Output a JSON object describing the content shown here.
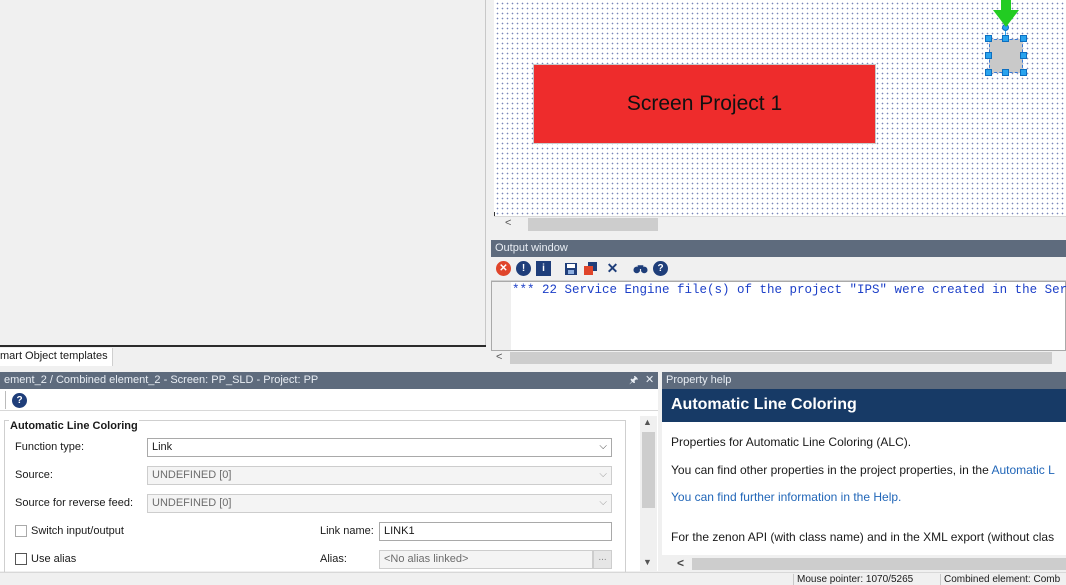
{
  "left_panel": {
    "tab_label": "mart Object templates"
  },
  "screen_editor": {
    "rect_label": "Screen  Project 1",
    "rect_color": "#ee2c2c",
    "selection_color": "#29a3ee",
    "arrow_color": "#22cc22"
  },
  "output_window": {
    "title": "Output window",
    "toolbar_icons": [
      "error-filter-icon",
      "warning-filter-icon",
      "info-filter-icon",
      "save-icon",
      "copy-icon",
      "clear-icon",
      "find-icon",
      "help-icon"
    ],
    "line": "*** 22 Service Engine file(s) of the project \"IPS\" were created in the Ser"
  },
  "properties": {
    "title": "ement_2 / Combined element_2 - Screen: PP_SLD - Project: PP",
    "pin_glyph": "🖈",
    "close_glyph": "✕",
    "help_glyph": "?",
    "group_title": "Automatic Line Coloring",
    "function_type": {
      "label": "Function type:",
      "value": "Link"
    },
    "source": {
      "label": "Source:",
      "value": "UNDEFINED [0]"
    },
    "source_reverse": {
      "label": "Source for reverse feed:",
      "value": "UNDEFINED [0]"
    },
    "switch_io": {
      "label": "Switch input/output"
    },
    "link_name": {
      "label": "Link name:",
      "value": "LINK1"
    },
    "use_alias": {
      "label": "Use alias"
    },
    "alias": {
      "label": "Alias:",
      "value": "<No alias linked>",
      "button": "..."
    }
  },
  "property_help": {
    "title": "Property help",
    "header": "Automatic Line Coloring",
    "p1": "Properties for Automatic Line Coloring (ALC).",
    "p2_text": "You can find other properties in the project properties, in the ",
    "p2_link": "Automatic L",
    "p3_link": "You can find further information in the Help.",
    "p4": "For the zenon API (with class name) and in the XML export (without clas"
  },
  "status_bar": {
    "mouse_pointer": "Mouse pointer: 1070/5265",
    "combined_element": "Combined element: Comb"
  }
}
